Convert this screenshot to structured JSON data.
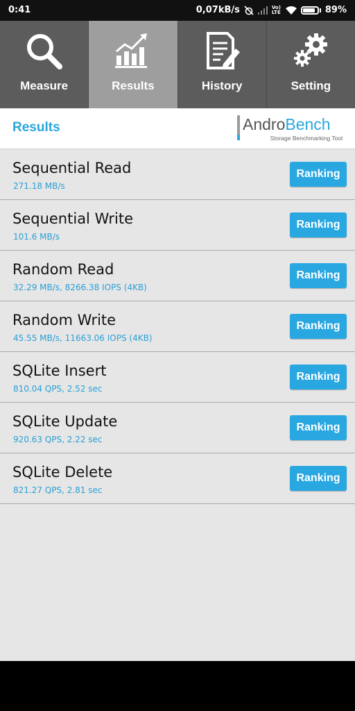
{
  "status_bar": {
    "time": "0:41",
    "net_speed": "0,07kB/s",
    "volte": "Vo) LTE",
    "battery_percent": "89%",
    "battery_level": 0.89
  },
  "tabs": [
    {
      "label": "Measure",
      "icon": "search-icon",
      "active": false
    },
    {
      "label": "Results",
      "icon": "chart-icon",
      "active": true
    },
    {
      "label": "History",
      "icon": "document-edit-icon",
      "active": false
    },
    {
      "label": "Setting",
      "icon": "gears-icon",
      "active": false
    }
  ],
  "header": {
    "title": "Results",
    "logo_part1": "Andro",
    "logo_part2": "Bench",
    "logo_tagline": "Storage Benchmarking Tool"
  },
  "colors": {
    "accent": "#29a7dd",
    "tab_bg": "#5c5c5c",
    "tab_active_bg": "#9e9e9e"
  },
  "results": [
    {
      "name": "Sequential Read",
      "value": "271.18 MB/s",
      "button": "Ranking"
    },
    {
      "name": "Sequential Write",
      "value": "101.6 MB/s",
      "button": "Ranking"
    },
    {
      "name": "Random Read",
      "value": "32.29 MB/s, 8266.38 IOPS (4KB)",
      "button": "Ranking"
    },
    {
      "name": "Random Write",
      "value": "45.55 MB/s, 11663.06 IOPS (4KB)",
      "button": "Ranking"
    },
    {
      "name": "SQLite Insert",
      "value": "810.04 QPS, 2.52 sec",
      "button": "Ranking"
    },
    {
      "name": "SQLite Update",
      "value": "920.63 QPS, 2.22 sec",
      "button": "Ranking"
    },
    {
      "name": "SQLite Delete",
      "value": "821.27 QPS, 2.81 sec",
      "button": "Ranking"
    }
  ]
}
